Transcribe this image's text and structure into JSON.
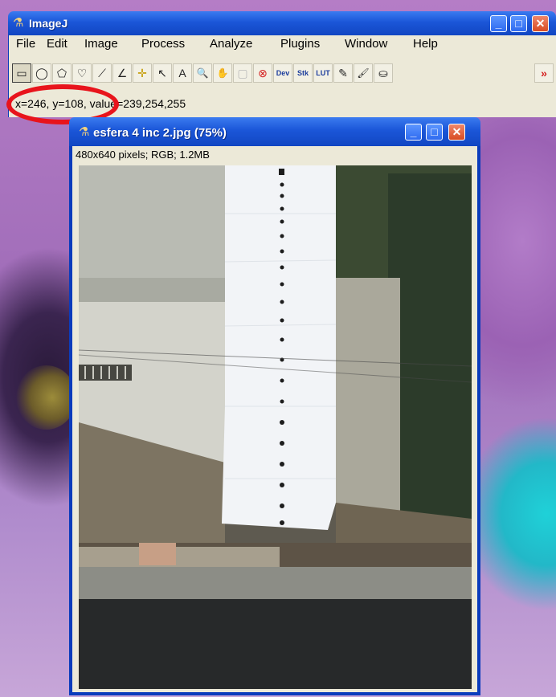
{
  "app": {
    "title": "ImageJ",
    "menu": [
      "File",
      "Edit",
      "Image",
      "Process",
      "Analyze",
      "Plugins",
      "Window",
      "Help"
    ],
    "toolbar": [
      {
        "icon": "rectangle-tool-icon",
        "glyph": "▭"
      },
      {
        "icon": "oval-tool-icon",
        "glyph": "◯"
      },
      {
        "icon": "polygon-tool-icon",
        "glyph": "⬠"
      },
      {
        "icon": "freehand-tool-icon",
        "glyph": "♡"
      },
      {
        "icon": "line-tool-icon",
        "glyph": "⟋"
      },
      {
        "icon": "angle-tool-icon",
        "glyph": "∠"
      },
      {
        "icon": "point-tool-icon",
        "glyph": "✛"
      },
      {
        "icon": "wand-tool-icon",
        "glyph": "↖"
      },
      {
        "icon": "text-tool-icon",
        "glyph": "A"
      },
      {
        "icon": "magnifier-tool-icon",
        "glyph": "🔍"
      },
      {
        "icon": "hand-tool-icon",
        "glyph": "✋"
      },
      {
        "icon": "dropper-tool-icon",
        "glyph": "▢"
      },
      {
        "icon": "close-circle-icon",
        "glyph": "⊗"
      },
      {
        "icon": "dev-menu-icon",
        "glyph": "Dev"
      },
      {
        "icon": "stk-menu-icon",
        "glyph": "Stk"
      },
      {
        "icon": "lut-menu-icon",
        "glyph": "LUT"
      },
      {
        "icon": "pencil-tool-icon",
        "glyph": "✎"
      },
      {
        "icon": "brush-tool-icon",
        "glyph": "🖌"
      },
      {
        "icon": "flood-fill-tool-icon",
        "glyph": "⛀"
      },
      {
        "icon": "more-tools-icon",
        "glyph": "»"
      }
    ],
    "status": "x=246, y=108, value=239,254,255"
  },
  "image_window": {
    "title": "esfera 4 inc 2.jpg (75%)",
    "info": "480x640 pixels; RGB; 1.2MB"
  },
  "colors": {
    "xp_blue": "#1b56d8",
    "xp_face": "#ece9d8",
    "highlight_red": "#e8141c"
  }
}
